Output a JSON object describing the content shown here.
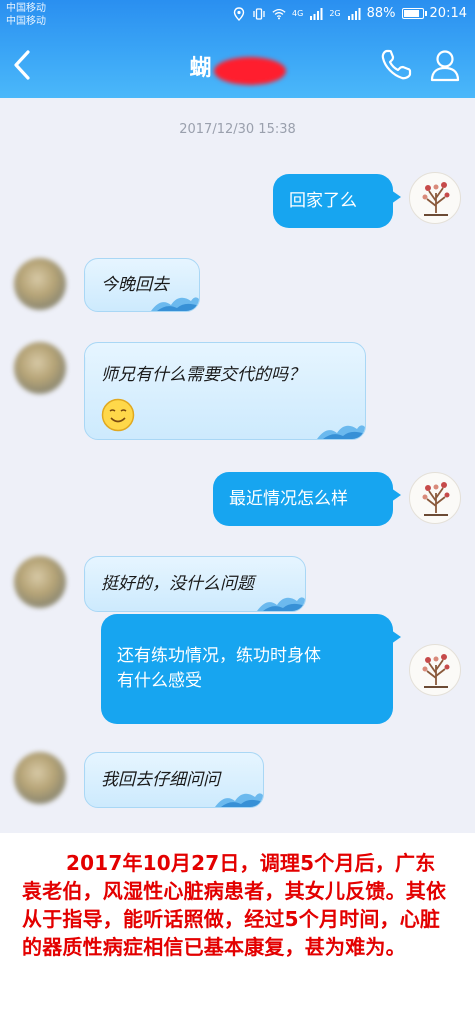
{
  "status_bar": {
    "carrier_1": "中国移动",
    "carrier_2": "中国移动",
    "network_1": "4G",
    "network_2": "2G",
    "battery": "88%",
    "time": "20:14"
  },
  "header": {
    "title": "蝴",
    "back_icon": "chevron-left-icon",
    "call_icon": "phone-icon",
    "profile_icon": "person-icon"
  },
  "chat": {
    "timestamp": "2017/12/30 15:38",
    "messages": [
      {
        "side": "right",
        "text": "回家了么"
      },
      {
        "side": "left",
        "text": "今晚回去"
      },
      {
        "side": "left",
        "text": "师兄有什么需要交代的吗？",
        "emoji": "smiling-face-icon"
      },
      {
        "side": "right",
        "text": "最近情况怎么样"
      },
      {
        "side": "left",
        "text": "挺好的，没什么问题"
      },
      {
        "side": "right",
        "line1": "还有练功情况，练功时身体",
        "line2": "有什么感受"
      },
      {
        "side": "left",
        "text": "我回去仔细问问"
      }
    ]
  },
  "caption": {
    "text": "2017年10月27日，调理5个月后，广东袁老伯，风湿性心脏病患者，其女儿反馈。其依从于指导，能听话照做，经过5个月时间，心脏的器质性病症相信已基本康复，甚为难为。"
  },
  "colors": {
    "header_blue": "#2a8ff0",
    "bubble_blue": "#17a5f0",
    "chat_bg": "#eef0f8",
    "caption_red": "#e30000"
  }
}
